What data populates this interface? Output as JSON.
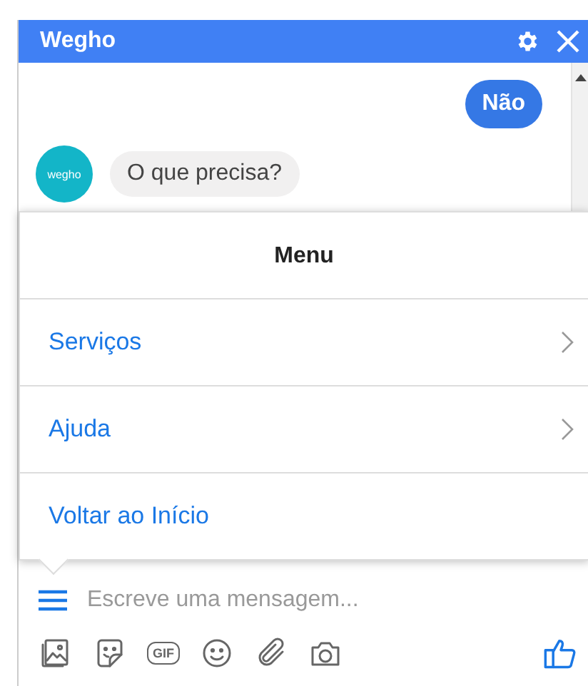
{
  "window": {
    "title": "Wegho"
  },
  "messages": [
    {
      "kind": "outgoing",
      "text": "Não"
    },
    {
      "kind": "incoming",
      "avatar": "wegho",
      "text": "O que precisa?"
    }
  ],
  "menu": {
    "title": "Menu",
    "items": [
      {
        "label": "Serviços",
        "has_submenu": true
      },
      {
        "label": "Ajuda",
        "has_submenu": true
      },
      {
        "label": "Voltar ao Início",
        "has_submenu": false
      }
    ]
  },
  "composer": {
    "placeholder": "Escreve uma mensagem...",
    "gif_label": "GIF"
  }
}
